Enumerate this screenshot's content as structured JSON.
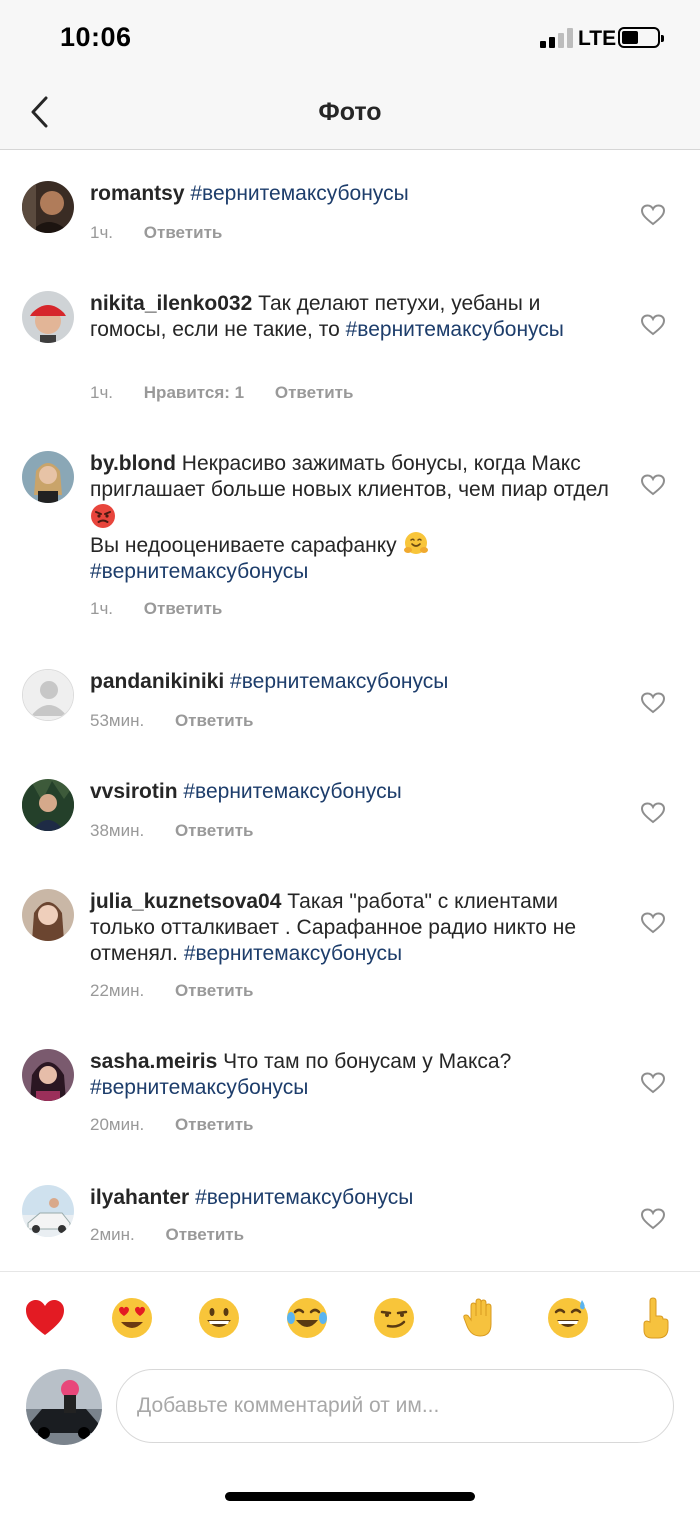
{
  "status_bar": {
    "time": "10:06",
    "network": "LTE"
  },
  "header": {
    "title": "Фото"
  },
  "comments": [
    {
      "username": "romantsy",
      "text": "",
      "hashtag": "#вернитемаксубонусы",
      "time": "1ч.",
      "likes": "",
      "reply": "Ответить"
    },
    {
      "username": "nikita_ilenko032",
      "text": "Так делают петухи, уебаны и гомосы, если не такие, то",
      "hashtag": "#вернитемаксубонусы",
      "time": "1ч.",
      "likes": "Нравится: 1",
      "reply": "Ответить"
    },
    {
      "username": "by.blond",
      "text": "Некрасиво зажимать бонусы, когда Макс приглашает больше новых клиентов, чем пиар отдел",
      "text2": "Вы недооцениваете сарафанку",
      "hashtag": "#вернитемаксубонусы",
      "time": "1ч.",
      "likes": "",
      "reply": "Ответить"
    },
    {
      "username": "pandanikiniki",
      "text": "",
      "hashtag": "#вернитемаксубонусы",
      "time": "53мин.",
      "likes": "",
      "reply": "Ответить"
    },
    {
      "username": "vvsirotin",
      "text": "",
      "hashtag": "#вернитемаксубонусы",
      "time": "38мин.",
      "likes": "",
      "reply": "Ответить"
    },
    {
      "username": "julia_kuznetsova04",
      "text": "Такая \"работа\" с клиентами только отталкивает . Сарафанное радио никто не отменял.",
      "hashtag": "#вернитемаксубонусы",
      "time": "22мин.",
      "likes": "",
      "reply": "Ответить"
    },
    {
      "username": "sasha.meiris",
      "text": "Что там по бонусам у Макса?",
      "hashtag": "#вернитемаксубонусы",
      "time": "20мин.",
      "likes": "",
      "reply": "Ответить"
    },
    {
      "username": "ilyahanter",
      "text": "",
      "hashtag": "#вернитемаксубонусы",
      "time": "2мин.",
      "likes": "",
      "reply": "Ответить"
    }
  ],
  "emoji_bar": [
    "red-heart",
    "heart-eyes",
    "grinning-face",
    "tears-of-joy",
    "smirking-face",
    "raised-hand",
    "sweat-smile",
    "index-pointing-up"
  ],
  "composer": {
    "placeholder": "Добавьте комментарий от им..."
  },
  "colors": {
    "hashtag": "#1d3d6b",
    "meta": "#999999",
    "bar_bg": "#f7f7f7"
  }
}
